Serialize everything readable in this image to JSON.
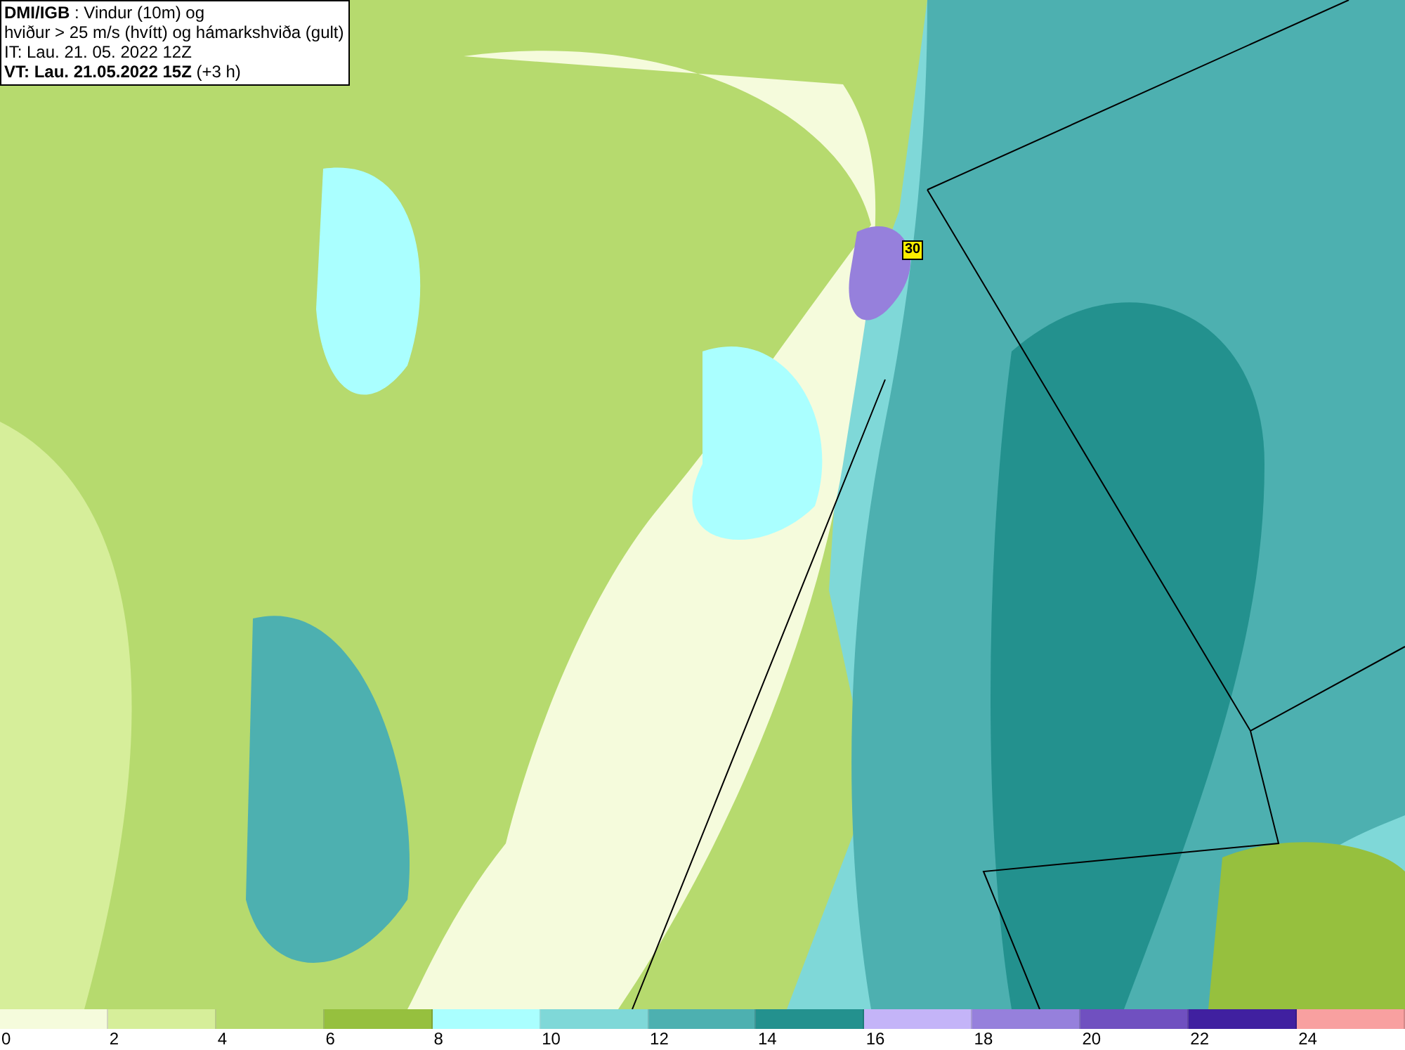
{
  "title_box": {
    "lines": [
      "**DMI/IGB** : Vindur (10m) og",
      "hviður > 25 m/s (hvítt) og hámarkshviða (gult)",
      "IT: Lau. 21. 05. 2022 12Z",
      "**VT: Lau. 21.05.2022 15Z** (+3 h)"
    ]
  },
  "map": {
    "gust_labels": [
      "30"
    ]
  },
  "legend": [
    {
      "label": "0",
      "color": "#f5fbdc"
    },
    {
      "label": "2",
      "color": "#d6ee9a"
    },
    {
      "label": "4",
      "color": "#b6da6e"
    },
    {
      "label": "6",
      "color": "#96c03e"
    },
    {
      "label": "8",
      "color": "#aaffff"
    },
    {
      "label": "10",
      "color": "#7fd8d8"
    },
    {
      "label": "12",
      "color": "#4db0b0"
    },
    {
      "label": "14",
      "color": "#23918e"
    },
    {
      "label": "16",
      "color": "#c4b4f8"
    },
    {
      "label": "18",
      "color": "#9680dc"
    },
    {
      "label": "20",
      "color": "#7050c0"
    },
    {
      "label": "22",
      "color": "#4020a0"
    },
    {
      "label": "24",
      "color": "#f8a0a0"
    }
  ]
}
